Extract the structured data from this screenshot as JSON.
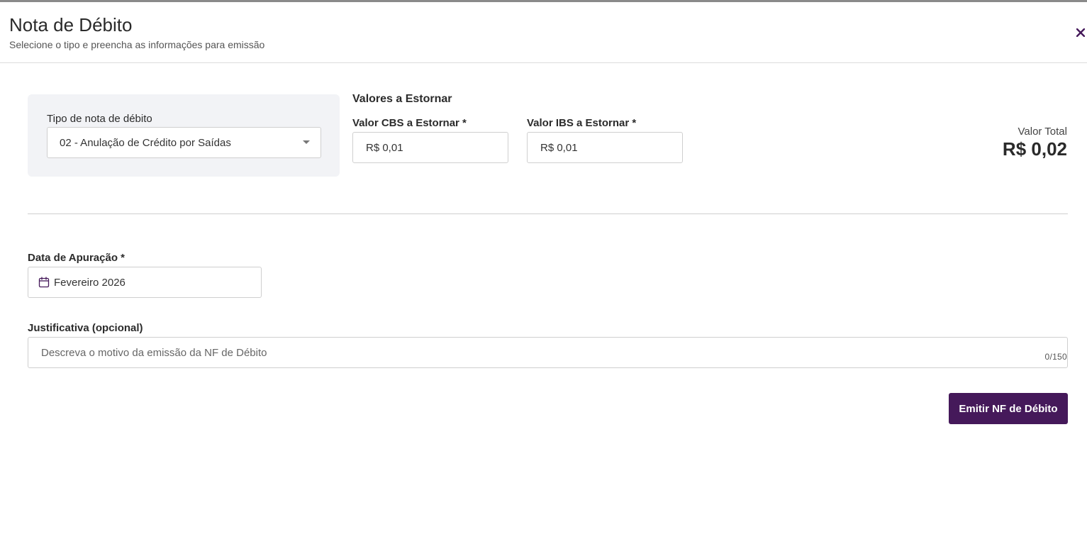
{
  "header": {
    "title": "Nota de Débito",
    "subtitle": "Selecione o tipo e preencha as informações para emissão",
    "close_icon": "close-icon"
  },
  "debit_type": {
    "label": "Tipo de nota de débito",
    "selected": "02 - Anulação de Crédito por Saídas"
  },
  "values": {
    "heading": "Valores a Estornar",
    "cbs": {
      "label": "Valor CBS a Estornar *",
      "value": "R$ 0,01"
    },
    "ibs": {
      "label": "Valor IBS a Estornar *",
      "value": "R$ 0,01"
    },
    "total_label": "Valor Total",
    "total_value": "R$ 0,02"
  },
  "apuracao": {
    "label": "Data de Apuração *",
    "value": "Fevereiro 2026",
    "icon": "calendar-icon"
  },
  "justificativa": {
    "label": "Justificativa (opcional)",
    "placeholder": "Descreva o motivo da emissão da NF de Débito",
    "counter": "0/150"
  },
  "actions": {
    "emit_label": "Emitir NF de Débito"
  },
  "colors": {
    "primary": "#45195a",
    "panel_bg": "#f2f3f6",
    "border": "#cfcfcf"
  }
}
